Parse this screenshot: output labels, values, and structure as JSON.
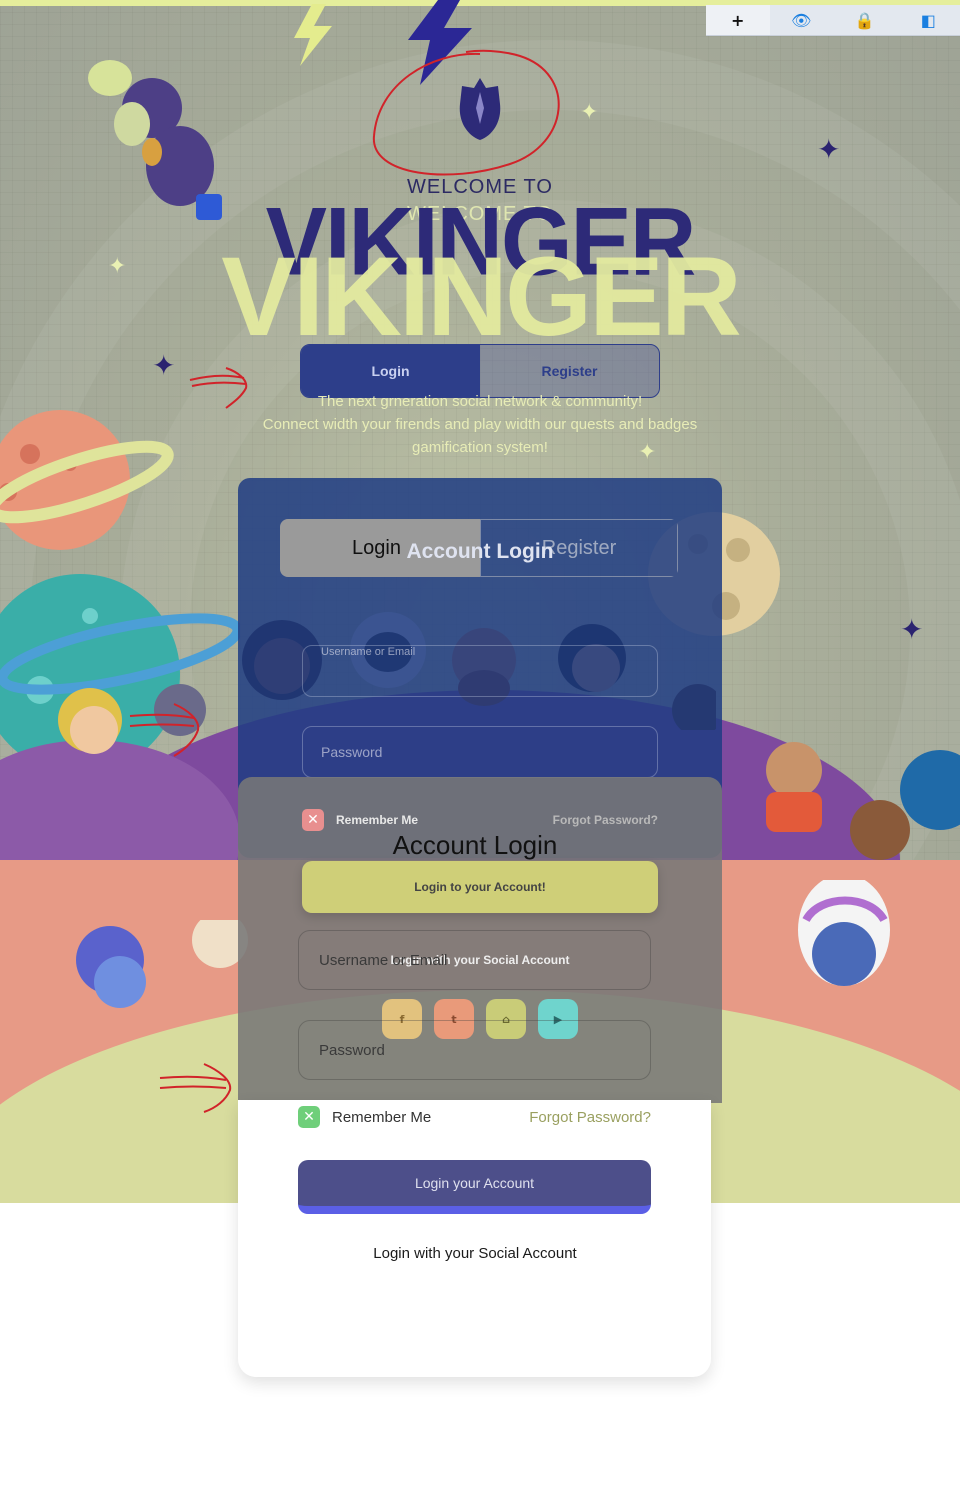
{
  "toolbar": {
    "items": [
      {
        "icon": "plus-icon",
        "glyph": "+"
      },
      {
        "icon": "eye-icon",
        "glyph": "👁"
      },
      {
        "icon": "lock-icon",
        "glyph": "🔒"
      },
      {
        "icon": "panel-icon",
        "glyph": "◧"
      }
    ]
  },
  "hero": {
    "welcome": "WELCOME TO",
    "brand": "VIKINGER",
    "tagline_1": "The next grneration social network & community!",
    "tagline_2": "Connect width your firends and play width our quests and badges",
    "tagline_3": "gamification system!"
  },
  "switch": {
    "login_label": "Login",
    "register_label": "Register"
  },
  "back_form": {
    "tab_login": "Login",
    "tab_register": "Register",
    "title": "Account Login",
    "username_placeholder": "Username or Email",
    "password_placeholder": "Password"
  },
  "overlay_form": {
    "remember_label": "Remember Me",
    "forgot_label": "Forgot Password?",
    "title": "Account Login",
    "submit_label": "Login to your Account!",
    "social_label": "Login with your Social Account",
    "socials": [
      {
        "name": "facebook-icon",
        "glyph": "f",
        "color": "#e2c27e"
      },
      {
        "name": "twitter-icon",
        "glyph": "t",
        "color": "#e99a7a"
      },
      {
        "name": "twitch-icon",
        "glyph": "⌂",
        "color": "#c9cc78"
      },
      {
        "name": "youtube-icon",
        "glyph": "▶",
        "color": "#6fd4cd"
      }
    ]
  },
  "card_form": {
    "username_label": "Username or Email",
    "password_label": "Password",
    "remember_label": "Remember Me",
    "forgot_label": "Forgot Password?",
    "submit_label": "Login your Account",
    "social_label": "Login with your Social Account"
  },
  "colors": {
    "accent_yellow": "#e3ea9f",
    "brand_navy": "#2d2a78",
    "button_purple": "#4d4f8a",
    "button_underline": "#5b5fe6"
  }
}
